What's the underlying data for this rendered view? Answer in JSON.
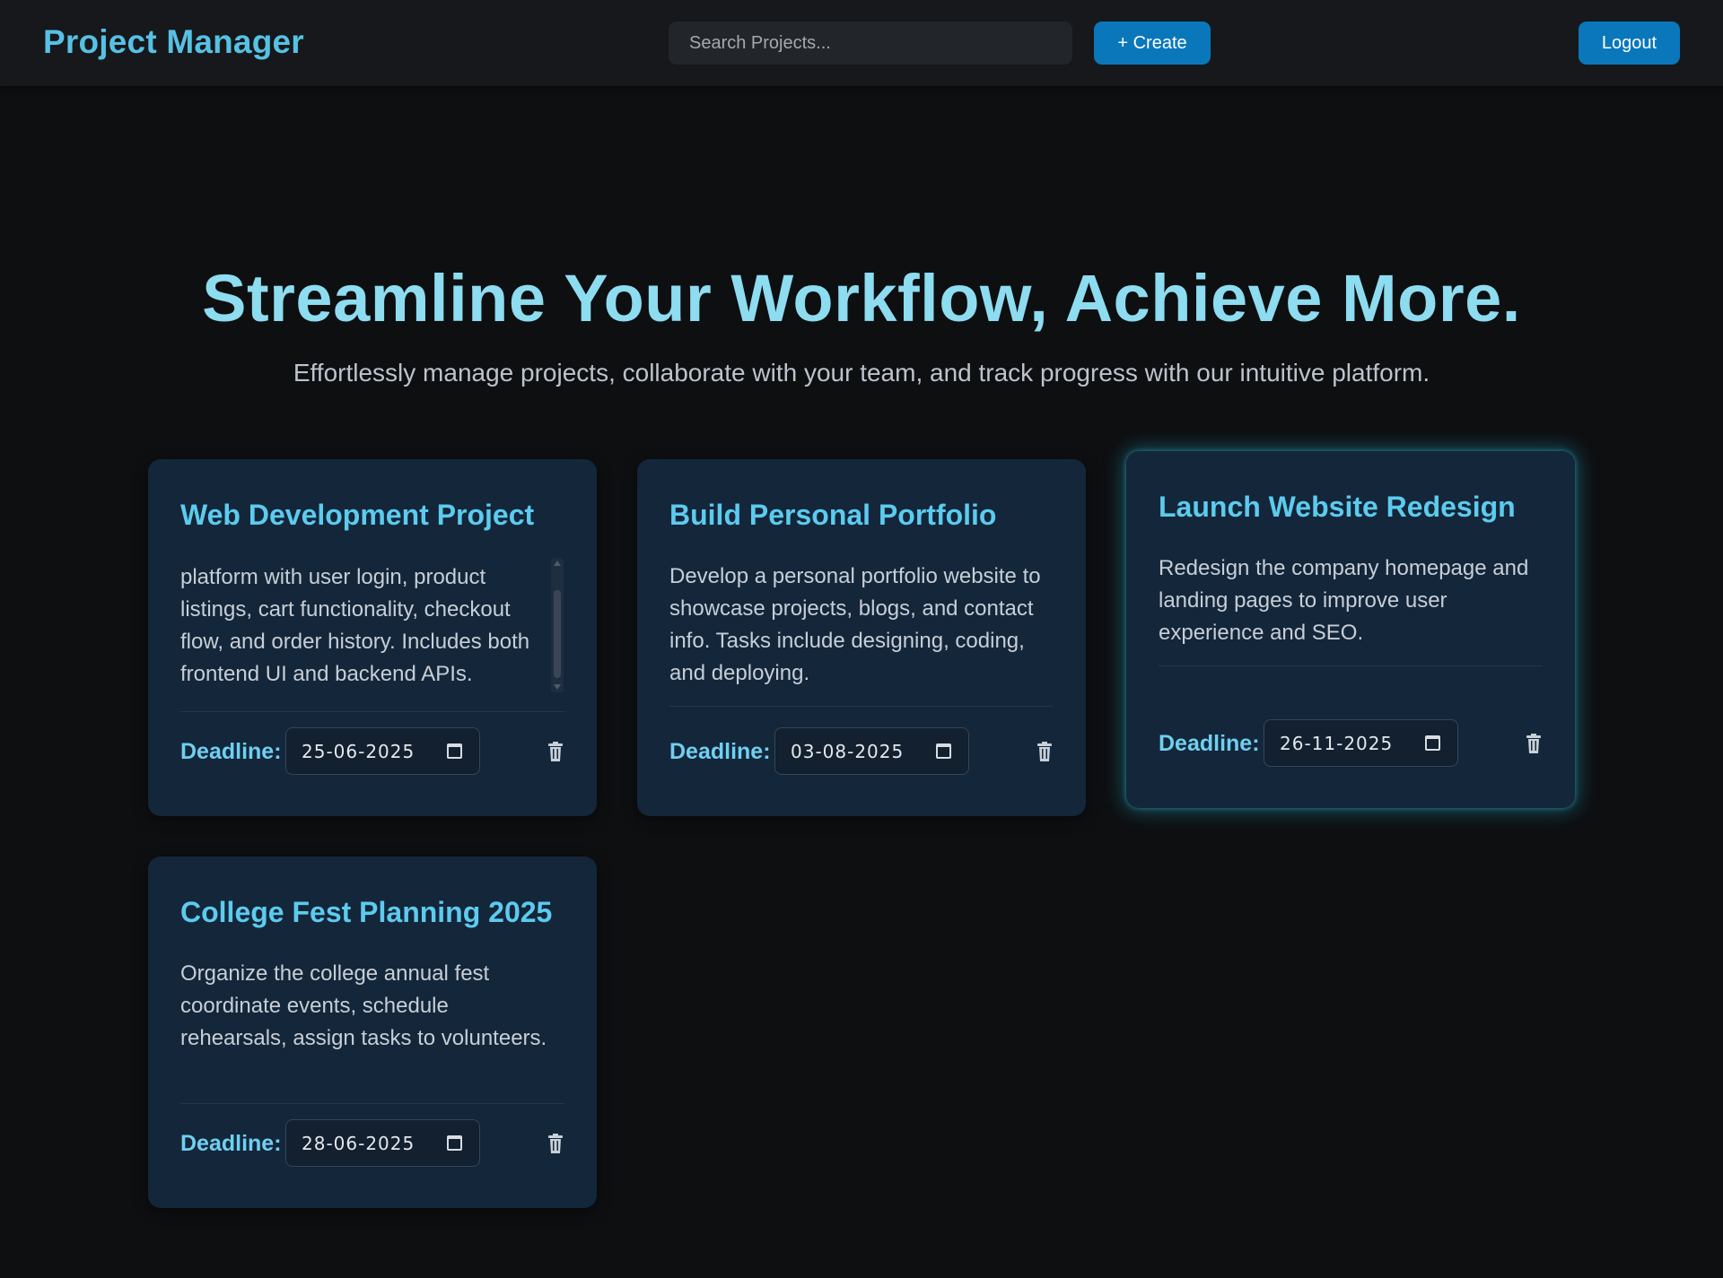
{
  "app": {
    "brand": "Project Manager"
  },
  "navbar": {
    "search_placeholder": "Search Projects...",
    "create_label": "+ Create",
    "logout_label": "Logout"
  },
  "hero": {
    "title": "Streamline Your Workflow, Achieve More.",
    "subtitle": "Effortlessly manage projects, collaborate with your team, and track progress with our intuitive platform."
  },
  "projects": [
    {
      "title": "Web Development Project",
      "description": "platform with user login, product listings, cart functionality, checkout flow, and order history. Includes both frontend UI and backend APIs.",
      "deadline_label": "Deadline:",
      "deadline": "25-06-2025",
      "delete_icon": "trash-icon"
    },
    {
      "title": "Build Personal Portfolio",
      "description": "Develop a personal portfolio website to showcase projects, blogs, and contact info. Tasks include designing, coding, and deploying.",
      "deadline_label": "Deadline:",
      "deadline": "03-08-2025",
      "delete_icon": "trash-icon"
    },
    {
      "title": "Launch Website Redesign",
      "description": "Redesign the company homepage and landing pages to improve user experience and SEO.",
      "deadline_label": "Deadline:",
      "deadline": "26-11-2025",
      "delete_icon": "trash-icon"
    },
    {
      "title": "College Fest Planning 2025",
      "description": "Organize the college annual fest coordinate events, schedule rehearsals, assign tasks to volunteers.",
      "deadline_label": "Deadline:",
      "deadline": "28-06-2025",
      "delete_icon": "trash-icon"
    }
  ],
  "colors": {
    "background": "#0e0f11",
    "navbar": "#16181b",
    "brand": "#56c1e4",
    "accent_button": "#0a77bb",
    "hero_title": "#8ddcf0",
    "card": "#14263a",
    "card_title": "#5ccbee",
    "card_glow": "#21abc7"
  }
}
